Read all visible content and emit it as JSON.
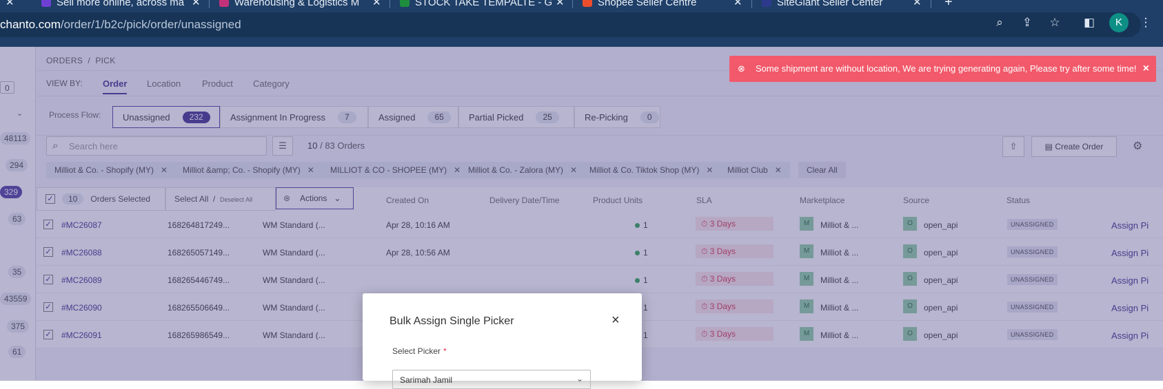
{
  "browser": {
    "tabs": [
      {
        "title": "Sell more online, across ma",
        "color": "#6f3fd4"
      },
      {
        "title": "Warehousing & Logistics M",
        "color": "#c2327a"
      },
      {
        "title": "STOCK TAKE TEMPALTE - G",
        "color": "#1e8e3e"
      },
      {
        "title": "Shopee Seller Centre",
        "color": "#ee4d2d"
      },
      {
        "title": "SiteGiant Seller Center",
        "color": "#2d3a8c"
      }
    ],
    "new_tab": "+",
    "url_host": "chanto.com",
    "url_path": "/order/1/b2c/pick/order/unassigned",
    "profile_initial": "K"
  },
  "sidebar": {
    "counts": [
      "0",
      "48113",
      "294",
      "329",
      "63",
      "35",
      "43559",
      "375",
      "61"
    ]
  },
  "breadcrumb": {
    "root": "ORDERS",
    "sep": "/",
    "current": "PICK"
  },
  "viewby": {
    "label": "VIEW BY:",
    "tabs": [
      "Order",
      "Location",
      "Product",
      "Category"
    ],
    "active": "Order"
  },
  "process_flow": {
    "label": "Process Flow:",
    "steps": [
      {
        "label": "Unassigned",
        "count": "232"
      },
      {
        "label": "Assignment In Progress",
        "count": "7"
      },
      {
        "label": "Assigned",
        "count": "65"
      },
      {
        "label": "Partial Picked",
        "count": "25"
      },
      {
        "label": "Re-Picking",
        "count": "0"
      }
    ]
  },
  "toolbar": {
    "search_placeholder": "Search here",
    "order_count_shown": "10",
    "order_count_total": "/ 83 Orders",
    "create_label": "Create Order"
  },
  "filters": {
    "chips": [
      "Milliot & Co. - Shopify (MY)",
      "Milliot &amp; Co. - Shopify (MY)",
      "MILLIOT & CO - SHOPEE (MY)",
      "Milliot & Co. - Zalora (MY)",
      "Milliot & Co. Tiktok Shop (MY)",
      "Milliot Club"
    ],
    "clear_all": "Clear All"
  },
  "selection": {
    "count": "10",
    "label": "Orders Selected",
    "select_all": "Select All",
    "sep": "/",
    "deselect_all": "Deselect All",
    "actions": "Actions"
  },
  "table": {
    "headers": [
      "Created On",
      "Delivery Date/Time",
      "Product Units",
      "SLA",
      "Marketplace",
      "Source",
      "Status"
    ],
    "rows": [
      {
        "order": "#MC26087",
        "ref": "168264817249...",
        "service": "WM Standard (...",
        "created": "Apr 28, 10:16 AM",
        "units": "1",
        "sla": "3 Days",
        "mp_initial": "M",
        "marketplace": "Milliot & ...",
        "src_initial": "O",
        "source": "open_api",
        "status": "UNASSIGNED",
        "action": "Assign Pi"
      },
      {
        "order": "#MC26088",
        "ref": "168265057149...",
        "service": "WM Standard (...",
        "created": "Apr 28, 10:56 AM",
        "units": "1",
        "sla": "3 Days",
        "mp_initial": "M",
        "marketplace": "Milliot & ...",
        "src_initial": "O",
        "source": "open_api",
        "status": "UNASSIGNED",
        "action": "Assign Pi"
      },
      {
        "order": "#MC26089",
        "ref": "168265446749...",
        "service": "WM Standard (...",
        "created": "",
        "units": "1",
        "sla": "3 Days",
        "mp_initial": "M",
        "marketplace": "Milliot & ...",
        "src_initial": "O",
        "source": "open_api",
        "status": "UNASSIGNED",
        "action": "Assign Pi"
      },
      {
        "order": "#MC26090",
        "ref": "168265506649...",
        "service": "WM Standard (...",
        "created": "",
        "units": "1",
        "sla": "3 Days",
        "mp_initial": "M",
        "marketplace": "Milliot & ...",
        "src_initial": "O",
        "source": "open_api",
        "status": "UNASSIGNED",
        "action": "Assign Pi"
      },
      {
        "order": "#MC26091",
        "ref": "168265986549...",
        "service": "WM Standard (...",
        "created": "",
        "units": "1",
        "sla": "3 Days",
        "mp_initial": "M",
        "marketplace": "Milliot & ...",
        "src_initial": "O",
        "source": "open_api",
        "status": "UNASSIGNED",
        "action": "Assign Pi"
      }
    ]
  },
  "toast": {
    "message": "Some shipment are without location, We are trying generating again, Please try after some time!",
    "close": "×"
  },
  "modal": {
    "title": "Bulk Assign Single Picker",
    "close": "×",
    "field_label": "Select Picker",
    "required_mark": "*",
    "selected_value": "Sarimah Jamil"
  }
}
